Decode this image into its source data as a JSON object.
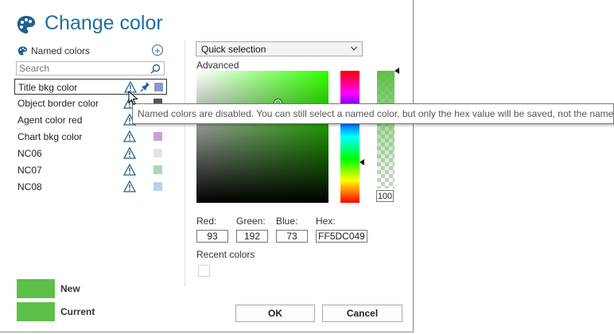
{
  "dialog": {
    "title": "Change color"
  },
  "named_colors": {
    "header": "Named colors",
    "add_symbol": "+",
    "search_placeholder": "Search",
    "items": [
      {
        "name": "Title bkg color",
        "swatch": "#8899cc",
        "selected": true
      },
      {
        "name": "Object border color",
        "swatch": "#555555"
      },
      {
        "name": "Agent color red",
        "swatch": "#f0a0a8"
      },
      {
        "name": "Chart bkg color",
        "swatch": "#c8a0d8"
      },
      {
        "name": "NC06",
        "swatch": "#e4e4e4"
      },
      {
        "name": "NC07",
        "swatch": "#a8d8b8"
      },
      {
        "name": "NC08",
        "swatch": "#b8d0e8"
      }
    ]
  },
  "picker": {
    "mode_selected": "Quick selection",
    "advanced_label": "Advanced",
    "alpha_value": "100",
    "fields": {
      "red_label": "Red:",
      "red_value": "93",
      "green_label": "Green:",
      "green_value": "192",
      "blue_label": "Blue:",
      "blue_value": "73",
      "hex_label": "Hex:",
      "hex_value": "FF5DC049"
    },
    "recent_label": "Recent colors"
  },
  "preview": {
    "new_label": "New",
    "current_label": "Current",
    "new_color": "#5dc049",
    "current_color": "#5dc049"
  },
  "buttons": {
    "ok": "OK",
    "cancel": "Cancel"
  },
  "tooltip": "Named colors are disabled. You can still select a named color, but only the hex value will be saved, not the name.",
  "icons": [
    "palette-icon",
    "add-icon",
    "search-icon",
    "warning-icon",
    "pin-icon",
    "chevron-down-icon",
    "mouse-cursor-icon"
  ]
}
